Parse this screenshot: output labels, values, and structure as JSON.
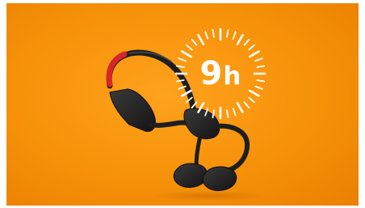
{
  "product": {
    "name": "bone-conduction-headphones",
    "body_color": "#202020",
    "accent_color": "#d7262a"
  },
  "badge": {
    "value": "9",
    "unit": "h",
    "text_color": "#ffffff"
  },
  "background": {
    "color": "#f69109"
  }
}
